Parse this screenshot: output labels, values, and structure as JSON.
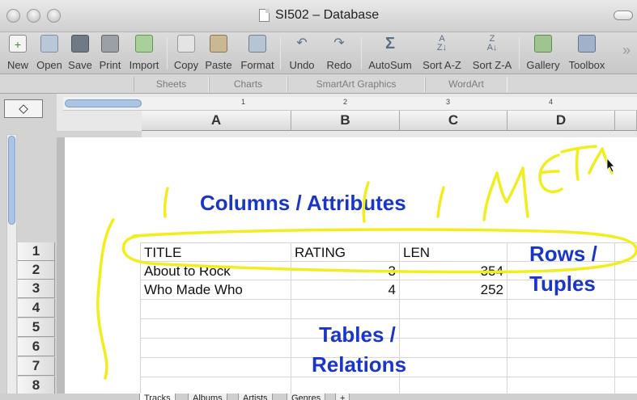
{
  "window": {
    "title": "SI502 – Database"
  },
  "toolbar": {
    "items": [
      {
        "label": "New",
        "icon": "new-doc-icon"
      },
      {
        "label": "Open",
        "icon": "open-folder-icon"
      },
      {
        "label": "Save",
        "icon": "save-icon"
      },
      {
        "label": "Print",
        "icon": "printer-icon"
      },
      {
        "label": "Import",
        "icon": "import-icon"
      },
      {
        "label": "Copy",
        "icon": "copy-icon"
      },
      {
        "label": "Paste",
        "icon": "paste-icon"
      },
      {
        "label": "Format",
        "icon": "format-brush-icon"
      },
      {
        "label": "Undo",
        "icon": "undo-icon"
      },
      {
        "label": "Redo",
        "icon": "redo-icon"
      },
      {
        "label": "AutoSum",
        "icon": "sigma-icon"
      },
      {
        "label": "Sort A-Z",
        "icon": "sort-az-icon"
      },
      {
        "label": "Sort Z-A",
        "icon": "sort-za-icon"
      },
      {
        "label": "Gallery",
        "icon": "gallery-icon"
      },
      {
        "label": "Toolbox",
        "icon": "toolbox-icon"
      }
    ],
    "more": "»"
  },
  "ribbon": {
    "tabs": [
      "Sheets",
      "Charts",
      "SmartArt Graphics",
      "WordArt"
    ]
  },
  "namebox": "◇",
  "ruler": {
    "marks": [
      "1",
      "2",
      "3",
      "4"
    ]
  },
  "columns": [
    "A",
    "B",
    "C",
    "D"
  ],
  "rows": [
    "1",
    "2",
    "3",
    "4",
    "5",
    "6",
    "7",
    "8"
  ],
  "table": {
    "header": [
      "TITLE",
      "RATING",
      "LEN"
    ],
    "rows": [
      [
        "About to Rock",
        "3",
        "354"
      ],
      [
        "Who Made Who",
        "4",
        "252"
      ]
    ]
  },
  "annotations": {
    "columns": "Columns / Attributes",
    "rows_line1": "Rows /",
    "rows_line2": "Tuples",
    "tables_line1": "Tables /",
    "tables_line2": "Relations",
    "handwriting": "META"
  },
  "sheet_tabs": [
    "Tracks",
    "Albums",
    "Artists",
    "Genres",
    "+"
  ],
  "colors": {
    "annotation_text": "#1a36c7",
    "highlighter": "#f2ee1d"
  }
}
